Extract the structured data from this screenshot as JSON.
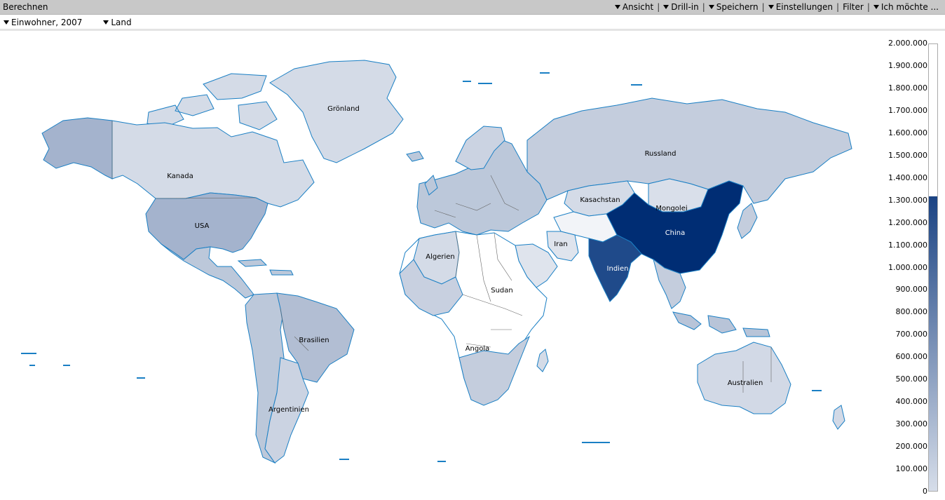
{
  "toolbar": {
    "title": "Berechnen",
    "menu": {
      "ansicht": "Ansicht",
      "drill_in": "Drill-in",
      "speichern": "Speichern",
      "einstellungen": "Einstellungen",
      "filter": "Filter",
      "ich_moechte": "Ich möchte ..."
    }
  },
  "filters": {
    "measure": "Einwohner, 2007",
    "dimension": "Land"
  },
  "map": {
    "labels": {
      "groenland": "Grönland",
      "kanada": "Kanada",
      "usa": "USA",
      "russland": "Russland",
      "kasachstan": "Kasachstan",
      "mongolei": "Mongolei",
      "china": "China",
      "iran": "Iran",
      "indien": "Indien",
      "algerien": "Algerien",
      "sudan": "Sudan",
      "angola": "Angola",
      "brasilien": "Brasilien",
      "argentinien": "Argentinien",
      "australien": "Australien"
    },
    "colors": {
      "border": "#1a7fc4",
      "scale_low": "#d6dde9",
      "scale_high": "#1b4383"
    }
  },
  "legend": {
    "ticks": [
      "2.000.000",
      "1.900.000",
      "1.800.000",
      "1.700.000",
      "1.600.000",
      "1.500.000",
      "1.400.000",
      "1.300.000",
      "1.200.000",
      "1.100.000",
      "1.000.000",
      "900.000",
      "800.000",
      "700.000",
      "600.000",
      "500.000",
      "400.000",
      "300.000",
      "200.000",
      "100.000",
      "0"
    ],
    "max_value": 2000000,
    "fill_value": 1320000
  }
}
